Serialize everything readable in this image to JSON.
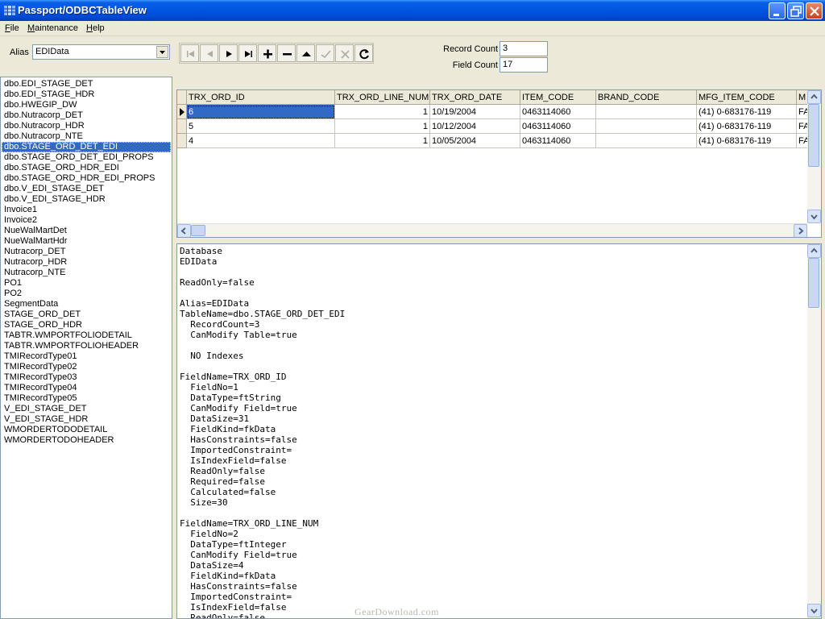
{
  "window": {
    "title": "Passport/ODBCTableView"
  },
  "menu": [
    {
      "label": "File",
      "accel": "F",
      "rest": "ile"
    },
    {
      "label": "Maintenance",
      "accel": "M",
      "rest": "aintenance"
    },
    {
      "label": "Help",
      "accel": "H",
      "rest": "elp"
    }
  ],
  "toolbar": {
    "alias_label": "Alias",
    "alias_value": "EDIData",
    "nav_buttons": [
      "first-record-icon",
      "prior-record-icon",
      "next-record-icon",
      "last-record-icon",
      "insert-record-icon",
      "delete-record-icon",
      "edit-record-icon",
      "post-record-icon",
      "cancel-record-icon",
      "refresh-icon"
    ],
    "record_count_label": "Record Count",
    "record_count": "3",
    "field_count_label": "Field Count",
    "field_count": "17"
  },
  "tables": {
    "selected_index": 6,
    "items": [
      "dbo.EDI_STAGE_DET",
      "dbo.EDI_STAGE_HDR",
      "dbo.HWEGIP_DW",
      "dbo.Nutracorp_DET",
      "dbo.Nutracorp_HDR",
      "dbo.Nutracorp_NTE",
      "dbo.STAGE_ORD_DET_EDI",
      "dbo.STAGE_ORD_DET_EDI_PROPS",
      "dbo.STAGE_ORD_HDR_EDI",
      "dbo.STAGE_ORD_HDR_EDI_PROPS",
      "dbo.V_EDI_STAGE_DET",
      "dbo.V_EDI_STAGE_HDR",
      "Invoice1",
      "Invoice2",
      "NueWalMartDet",
      "NueWalMartHdr",
      "Nutracorp_DET",
      "Nutracorp_HDR",
      "Nutracorp_NTE",
      "PO1",
      "PO2",
      "SegmentData",
      "STAGE_ORD_DET",
      "STAGE_ORD_HDR",
      "TABTR.WMPORTFOLIODETAIL",
      "TABTR.WMPORTFOLIOHEADER",
      "TMIRecordType01",
      "TMIRecordType02",
      "TMIRecordType03",
      "TMIRecordType04",
      "TMIRecordType05",
      "V_EDI_STAGE_DET",
      "V_EDI_STAGE_HDR",
      "WMORDERTODODETAIL",
      "WMORDERTODOHEADER"
    ]
  },
  "grid": {
    "columns": [
      "TRX_ORD_ID",
      "TRX_ORD_LINE_NUM",
      "TRX_ORD_DATE",
      "ITEM_CODE",
      "BRAND_CODE",
      "MFG_ITEM_CODE",
      "M"
    ],
    "rows": [
      [
        "6",
        "1",
        "10/19/2004",
        "0463114060",
        "",
        "(41) 0-683176-119",
        "FA"
      ],
      [
        "5",
        "1",
        "10/12/2004",
        "0463114060",
        "",
        "(41) 0-683176-119",
        "FA"
      ],
      [
        "4",
        "1",
        "10/05/2004",
        "0463114060",
        "",
        "(41) 0-683176-119",
        "FA"
      ]
    ]
  },
  "details": {
    "lines": [
      "Database",
      "EDIData",
      "",
      "ReadOnly=false",
      "",
      "Alias=EDIData",
      "TableName=dbo.STAGE_ORD_DET_EDI",
      "  RecordCount=3",
      "  CanModify Table=true",
      "",
      "  NO Indexes",
      "",
      "FieldName=TRX_ORD_ID",
      "  FieldNo=1",
      "  DataType=ftString",
      "  CanModify Field=true",
      "  DataSize=31",
      "  FieldKind=fkData",
      "  HasConstraints=false",
      "  ImportedConstraint=",
      "  IsIndexField=false",
      "  ReadOnly=false",
      "  Required=false",
      "  Calculated=false",
      "  Size=30",
      "",
      "FieldName=TRX_ORD_LINE_NUM",
      "  FieldNo=2",
      "  DataType=ftInteger",
      "  CanModify Field=true",
      "  DataSize=4",
      "  FieldKind=fkData",
      "  HasConstraints=false",
      "  ImportedConstraint=",
      "  IsIndexField=false",
      "  ReadOnly=false"
    ]
  },
  "watermark": "GearDownload.com"
}
